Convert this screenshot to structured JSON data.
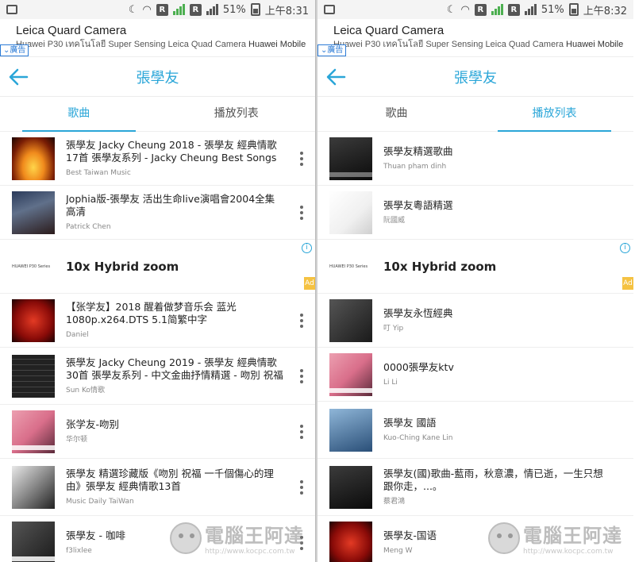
{
  "left": {
    "status": {
      "battery": "51%",
      "time": "上午8:31"
    },
    "ad_banner": {
      "title": "Leica Quard Camera",
      "subtitle_pre": "Huawei P30 เทคโนโลยี Super Sensing Leica Quad Camera",
      "subtitle_brand": "Huawei Mobile",
      "tag": "廣告"
    },
    "appbar": {
      "title": "張學友"
    },
    "tabs": [
      {
        "label": "歌曲",
        "active": true
      },
      {
        "label": "播放列表",
        "active": false
      }
    ],
    "items": [
      {
        "title": "張學友 Jacky Cheung 2018 - 張學友 經典情歌17首 張學友系列 - Jacky Cheung Best Songs 2018...",
        "sub": "Best Taiwan Music",
        "thumb": "fire"
      },
      {
        "title": "Jophia版-張學友 活出生命live演唱會2004全集 高清",
        "sub": "Patrick Chen",
        "thumb": "stage"
      },
      {
        "ad": true,
        "headline": "10x Hybrid zoom",
        "brand": "HUAWEI P30 Series"
      },
      {
        "title": "【张学友】2018 醒着做梦音乐会 蓝光1080p.x264.DTS 5.1简繁中字",
        "sub": "Daniel",
        "thumb": "red"
      },
      {
        "title": "張學友 Jacky Cheung 2019 - 張學友 經典情歌30首 張學友系列 - 中文金曲抒情精選 - 吻別 祝福 ...",
        "sub": "Sun Ko情歌",
        "thumb": "grid"
      },
      {
        "title": "张学友-吻别",
        "sub": "华尔顿",
        "thumb": "pink"
      },
      {
        "title": "張學友 精選珍藏版《吻別 祝福 一千個傷心的理由》張學友 經典情歌13首",
        "sub": "Music Daily TaiWan",
        "thumb": "bw"
      },
      {
        "title": "張學友 - 咖啡",
        "sub": "f3lixlee",
        "thumb": "dark"
      }
    ]
  },
  "right": {
    "status": {
      "battery": "51%",
      "time": "上午8:32"
    },
    "ad_banner": {
      "title": "Leica Quard Camera",
      "subtitle_pre": "Huawei P30 เทคโนโลยี Super Sensing Leica Quad Camera",
      "subtitle_brand": "Huawei Mobile",
      "tag": "廣告"
    },
    "appbar": {
      "title": "張學友"
    },
    "tabs": [
      {
        "label": "歌曲",
        "active": false
      },
      {
        "label": "播放列表",
        "active": true
      }
    ],
    "items": [
      {
        "title": "張學友精選歌曲",
        "sub": "Thuan pham dinh",
        "thumb": "face"
      },
      {
        "title": "張學友粵語精選",
        "sub": "阮國威",
        "thumb": "white"
      },
      {
        "ad": true,
        "headline": "10x Hybrid zoom",
        "brand": "HUAWEI P30 Series"
      },
      {
        "title": "張學友永恆經典",
        "sub": "叮 Yip",
        "thumb": "dark"
      },
      {
        "title": "0000張學友ktv",
        "sub": "Li Li",
        "thumb": "pink"
      },
      {
        "title": "張學友 國語",
        "sub": "Kuo-Ching Kane Lin",
        "thumb": "blue"
      },
      {
        "title": "張學友(國)歌曲-藍雨，秋意濃，情已逝，一生只想跟你走，...。",
        "sub": "蔡君鴻",
        "thumb": "face"
      },
      {
        "title": "張學友-国语",
        "sub": "Meng W",
        "thumb": "red"
      }
    ]
  },
  "watermark": {
    "name": "電腦王阿達",
    "url": "http://www.kocpc.com.tw"
  },
  "colors": {
    "accent": "#2aa6d8",
    "ad_tag": "#2b7bd6",
    "ad_corner": "#f5c242"
  }
}
